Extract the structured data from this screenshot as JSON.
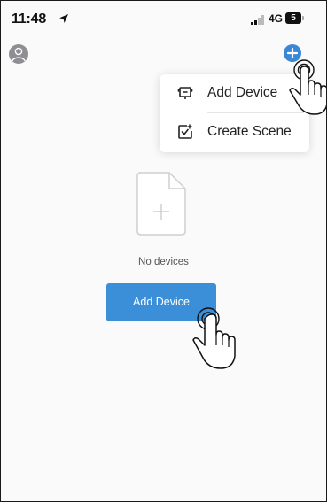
{
  "status_bar": {
    "time": "11:48",
    "network": "4G",
    "battery": "5"
  },
  "header": {
    "avatar_icon": "person-icon",
    "add_icon": "plus-icon",
    "accent_color": "#3a87d6"
  },
  "menu": {
    "items": [
      {
        "label": "Add Device",
        "icon": "device-icon"
      },
      {
        "label": "Create Scene",
        "icon": "scene-icon"
      }
    ]
  },
  "empty_state": {
    "icon": "new-document-icon",
    "message": "No devices",
    "button_label": "Add Device"
  },
  "overlays": {
    "tap_hand_icon": "tap-hand-icon"
  }
}
